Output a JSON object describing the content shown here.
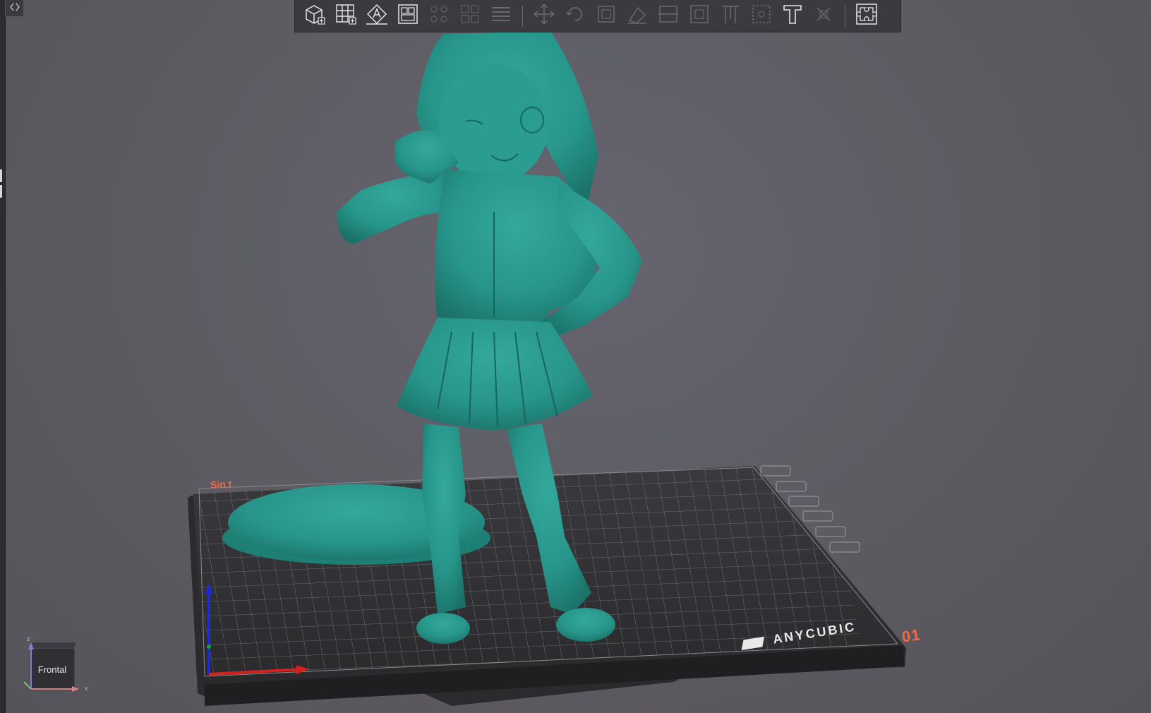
{
  "app": {
    "accent": "#3a3a3f",
    "model_color": "#27958a",
    "plate_accent": "#ef6b47"
  },
  "collapse_button": {
    "icon": "collapse-arrows-icon"
  },
  "toolbar": {
    "groups": [
      {
        "buttons": [
          {
            "icon": "add-cube-icon",
            "enabled": true
          },
          {
            "icon": "grid-add-icon",
            "enabled": true
          },
          {
            "icon": "auto-layout-icon",
            "enabled": true
          },
          {
            "icon": "layout-panel-icon",
            "enabled": true
          },
          {
            "icon": "arrange-grid-icon",
            "enabled": false
          },
          {
            "icon": "duplicate-grid-icon",
            "enabled": false
          },
          {
            "icon": "list-align-icon",
            "enabled": false
          }
        ]
      },
      {
        "buttons": [
          {
            "icon": "move-icon",
            "enabled": false
          },
          {
            "icon": "rotate-icon",
            "enabled": false
          },
          {
            "icon": "scale-icon",
            "enabled": false
          },
          {
            "icon": "mirror-icon",
            "enabled": false
          },
          {
            "icon": "cut-icon",
            "enabled": false
          },
          {
            "icon": "hollow-icon",
            "enabled": false
          },
          {
            "icon": "support-icon",
            "enabled": false
          },
          {
            "icon": "drill-icon",
            "enabled": false
          },
          {
            "icon": "text-icon",
            "enabled": true
          },
          {
            "icon": "repair-icon",
            "enabled": false
          }
        ]
      },
      {
        "buttons": [
          {
            "icon": "puzzle-icon",
            "enabled": true
          }
        ]
      }
    ]
  },
  "plate": {
    "name_label": "Sin t",
    "brand": "ANYCUBIC",
    "number": "01"
  },
  "view_cube": {
    "face_label": "Frontal",
    "axis_x": "x",
    "axis_z": "z"
  }
}
